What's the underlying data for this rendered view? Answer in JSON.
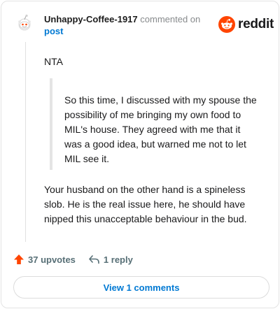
{
  "comment": {
    "author": "Unhappy-Coffee-1917",
    "action_text": "commented on",
    "post_link": "post",
    "brand": "reddit",
    "body_first": "NTA",
    "quote": "So this time, I discussed with my spouse the possibility of me bringing my own food to MIL's house. They agreed with me that it was a good idea, but warned me not to let MIL see it.",
    "body_second": "Your husband on the other hand is a spineless slob. He is the real issue here, he should have nipped this unacceptable behaviour in the bud."
  },
  "actions": {
    "upvotes": "37 upvotes",
    "replies": "1 reply",
    "view_comments": "View 1 comments"
  },
  "colors": {
    "reddit_orange": "#ff4500",
    "link_blue": "#0079d3",
    "meta_gray": "#878a8c"
  },
  "icons": {
    "avatar": "snoo-avatar-icon",
    "logo": "reddit-logo-icon",
    "upvote": "upvote-arrow-icon",
    "reply": "reply-arrow-icon"
  }
}
